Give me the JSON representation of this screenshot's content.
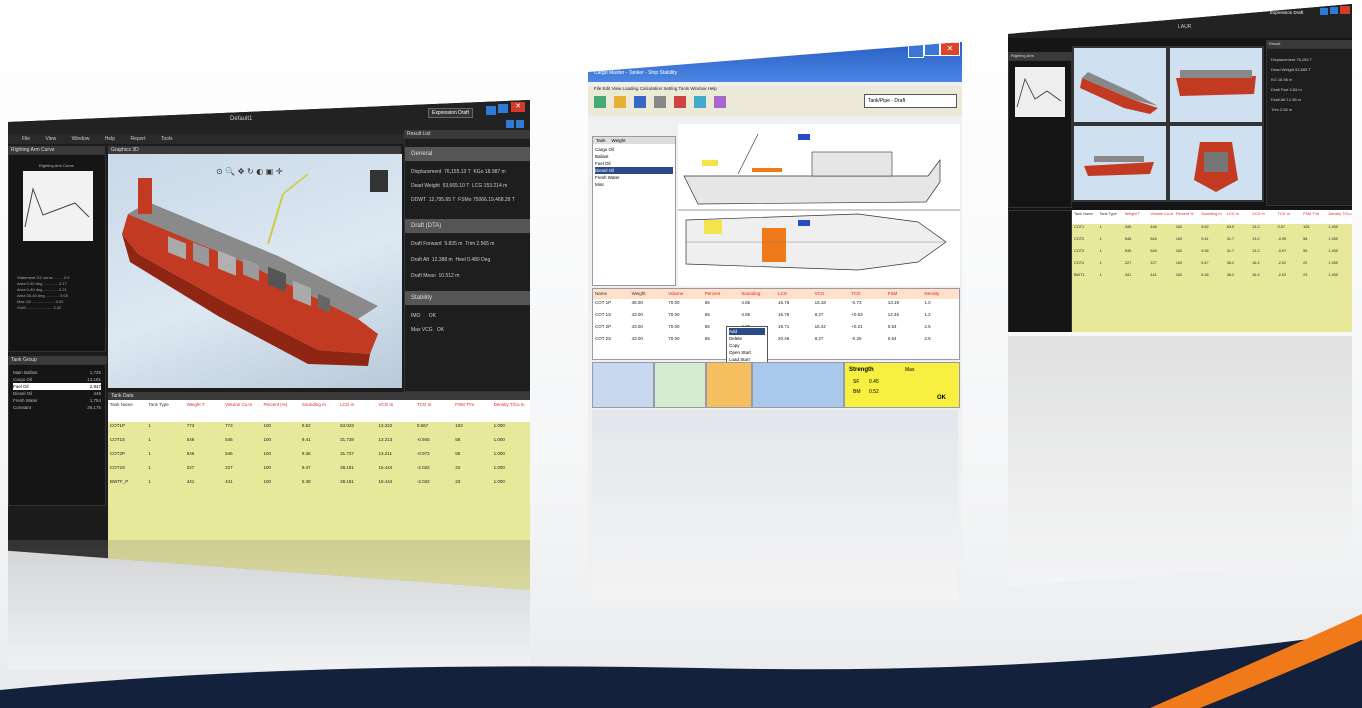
{
  "left_window": {
    "title": "Default1",
    "dropdown": "Expression Draft",
    "menu": [
      "File",
      "View",
      "Window",
      "Help",
      "Report",
      "Tools"
    ],
    "panel_left_title": "Righting Arm Curve",
    "panel_viewport_title": "Graphics 3D",
    "panel_right_title": "Result List",
    "chart_title": "Righting Arm Curve",
    "sections": {
      "general": "General",
      "draft": "Draft (DTA)",
      "stability": "Stability"
    },
    "general_rows": [
      {
        "label": "Displacement",
        "value": "76,155.13 T",
        "label2": "KGo",
        "value2": "18.987 m"
      },
      {
        "label": "Dead Weight",
        "value": "53,665.10 T",
        "label2": "LCG",
        "value2": "153.214 m"
      },
      {
        "label": "DDWT",
        "value": "12,795.65 T",
        "label2": "FSMo",
        "value2": "75066.19,468.28 T"
      }
    ],
    "draft_rows": [
      {
        "label": "Draft Forward",
        "value": "9.835 m",
        "label2": "Trim",
        "value2": "2.565 m"
      },
      {
        "label": "Draft Aft",
        "value": "12.388 m",
        "label2": "Heel",
        "value2": "0.480 Deg"
      },
      {
        "label": "Draft Mean",
        "value": "10.512 m"
      }
    ],
    "stability_rows": [
      {
        "label": "IMO",
        "value": "OK"
      },
      {
        "label": "Max VCG",
        "value": "OK"
      }
    ],
    "tank_panel_title": "Tank Data",
    "table_headers": [
      "Tank Name",
      "Tank Type",
      "Weight T",
      "Volume Cu.m",
      "Percent (%)",
      "Sounding m",
      "LCG m",
      "VCG m",
      "TCG m",
      "FSM T*m",
      "Density T/Cu.m"
    ],
    "table_rows": [
      [
        "COT1P",
        "1",
        "773",
        "773",
        "100",
        "9.52",
        "63.023",
        "13.222",
        "0.567",
        "103",
        "1.000"
      ],
      [
        "COT1S",
        "1",
        "546",
        "546",
        "100",
        "9.41",
        "31.738",
        "13.213",
        "-0.945",
        "58",
        "1.000"
      ],
      [
        "COT2P",
        "1",
        "546",
        "546",
        "100",
        "9.36",
        "31.737",
        "13.211",
        "-0.972",
        "55",
        "1.000"
      ],
      [
        "COT2S",
        "1",
        "227",
        "227",
        "100",
        "9.47",
        "38.181",
        "16.444",
        "-2.022",
        "22",
        "1.000"
      ],
      [
        "BWTF_P",
        "1",
        "441",
        "441",
        "100",
        "5.38",
        "38.181",
        "16.444",
        "-2.022",
        "23",
        "1.000"
      ],
      [
        "",
        "",
        "",
        "",
        "",
        "",
        "",
        "",
        "",
        "",
        ""
      ]
    ],
    "left_list_title": "Tank Group",
    "left_list": [
      [
        "Main Ballast",
        "1,725"
      ],
      [
        "Cargo Oil",
        "13,181"
      ],
      [
        "Fuel Oil",
        "2,947"
      ],
      [
        "Diesel Oil",
        "446"
      ],
      [
        "Fresh Water",
        "1,754"
      ],
      [
        "Constant",
        "26,175"
      ]
    ]
  },
  "middle_window": {
    "title": "Cargo Master - Tanker - Ship Stability",
    "dropdown": "Tank/Pipe - Draft",
    "menu": [
      "File",
      "Edit",
      "View",
      "Loading",
      "Calculation",
      "Setting",
      "Tools",
      "Window",
      "Help"
    ],
    "side_tabs": [
      "Tank",
      "Weight"
    ],
    "side_list": [
      "Cargo Oil",
      "Ballast",
      "Fuel Oil",
      "Diesel Oil",
      "Fresh Water",
      "Misc"
    ],
    "table_headers": [
      "Name",
      "Weight",
      "Volume",
      "Percent",
      "Sounding",
      "LCG",
      "VCG",
      "TCG",
      "FSM",
      "Density"
    ],
    "table_rows": [
      [
        "COT 1P",
        "46.00",
        "70.00",
        "65",
        "4.85",
        "16.76",
        "16.18",
        "-0.73",
        "13.19",
        "1.0"
      ],
      [
        "COT 1S",
        "43.00",
        "70.00",
        "65",
        "4.85",
        "16.76",
        "9.27",
        "+0.63",
        "12.46",
        "1.2"
      ],
      [
        "COT 2P",
        "43.00",
        "70.00",
        "65",
        "4.85",
        "19.71",
        "16.42",
        "+0.21",
        "0.54",
        "2.5"
      ],
      [
        "COT 2S",
        "43.00",
        "70.00",
        "65",
        "4.85",
        "20.46",
        "9.27",
        "-0.25",
        "0.64",
        "2.5"
      ]
    ],
    "popup": [
      "Add",
      "Delete",
      "Copy",
      "Open Start",
      "Load Start"
    ],
    "status": {
      "strength": "Strength",
      "sf": "SF",
      "bm": "BM",
      "max": "Max",
      "sf_val": "0.45",
      "bm_val": "0.52",
      "ok": "OK"
    }
  },
  "right_window": {
    "title": "LAUR",
    "dropdown": "Expression Draft",
    "panel_left_title": "Righting Arm",
    "panel_right_title": "Result",
    "table_headers": [
      "Tank Name",
      "Tank Type",
      "Weight T",
      "Volume Cu.m",
      "Percent %",
      "Sounding m",
      "LCG m",
      "VCG m",
      "TCG m",
      "FSM T*m",
      "Density T/Cu.m"
    ],
    "table_rows": [
      [
        "COT1",
        "1",
        "446",
        "446",
        "100",
        "9.52",
        "63.0",
        "13.2",
        "0.57",
        "103",
        "1.000"
      ],
      [
        "COT2",
        "1",
        "546",
        "546",
        "100",
        "9.41",
        "31.7",
        "13.2",
        "-0.95",
        "58",
        "1.000"
      ],
      [
        "COT3",
        "1",
        "546",
        "546",
        "100",
        "9.36",
        "31.7",
        "13.2",
        "-0.97",
        "55",
        "1.000"
      ],
      [
        "COT4",
        "1",
        "227",
        "227",
        "100",
        "9.47",
        "38.2",
        "16.4",
        "-2.02",
        "22",
        "1.000"
      ],
      [
        "BWT1",
        "1",
        "441",
        "441",
        "100",
        "5.38",
        "38.2",
        "16.4",
        "-2.02",
        "23",
        "1.000"
      ]
    ],
    "result_rows": [
      [
        "Displacement",
        "76,155 T"
      ],
      [
        "Dead Weight",
        "53,665 T"
      ],
      [
        "KG",
        "18.98 m"
      ],
      [
        "Draft Fwd",
        "9.83 m"
      ],
      [
        "Draft Aft",
        "12.38 m"
      ],
      [
        "Trim",
        "2.56 m"
      ]
    ]
  },
  "colors": {
    "hull_red": "#c23a22",
    "deck_gray": "#8a8a8a",
    "table_yellow": "#e8e89a",
    "accent_orange": "#f07a1a",
    "swoosh_navy": "#14213d",
    "title_blue": "#2a5fc6"
  }
}
